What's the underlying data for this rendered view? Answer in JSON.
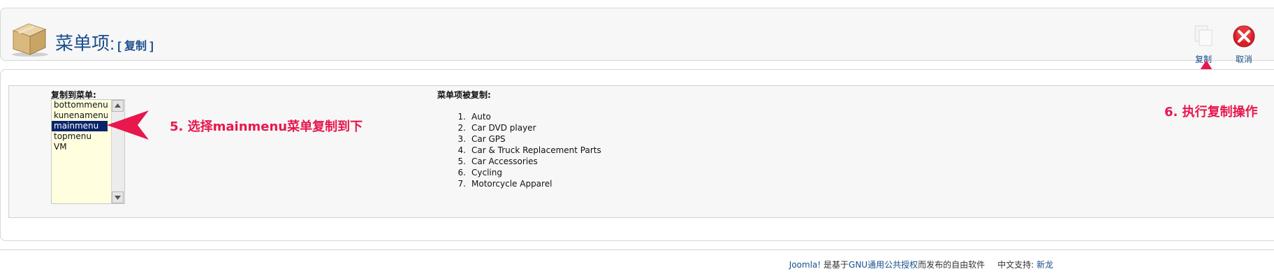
{
  "header": {
    "title": "菜单项:",
    "subtitle": "[ 复制 ]",
    "icon": "package-box-icon"
  },
  "toolbar": {
    "copy_label": "复制",
    "cancel_label": "取消",
    "copy_icon": "copy-icon",
    "cancel_icon": "cancel-icon"
  },
  "form": {
    "copy_to_label": "复制到菜单:",
    "copied_items_label": "菜单项被复制:",
    "menu_options": [
      "bottommenu",
      "kunenamenu",
      "mainmenu",
      "topmenu",
      "VM"
    ],
    "selected_menu": "mainmenu",
    "copied_items": [
      {
        "num": "1.",
        "name": "Auto"
      },
      {
        "num": "2.",
        "name": "Car DVD player"
      },
      {
        "num": "3.",
        "name": "Car GPS"
      },
      {
        "num": "4.",
        "name": "Car & Truck Replacement Parts"
      },
      {
        "num": "5.",
        "name": "Car Accessories"
      },
      {
        "num": "6.",
        "name": "Cycling"
      },
      {
        "num": "7.",
        "name": "Motorcycle Apparel"
      }
    ]
  },
  "annotations": {
    "step5": "5. 选择mainmenu菜单复制到下",
    "step6": "6. 执行复制操作"
  },
  "footer": {
    "joomla": "Joomla!",
    "text1": " 是基于",
    "gnu_link": "GNU通用公共授权",
    "text2": "而发布的自由软件",
    "support_label": "中文支持:",
    "support_link": "新龙"
  },
  "colors": {
    "accent": "#1a4e8c",
    "annotation": "#e8174e",
    "selected_option": "#0a246a",
    "listbox_bg": "#ffffe0"
  }
}
